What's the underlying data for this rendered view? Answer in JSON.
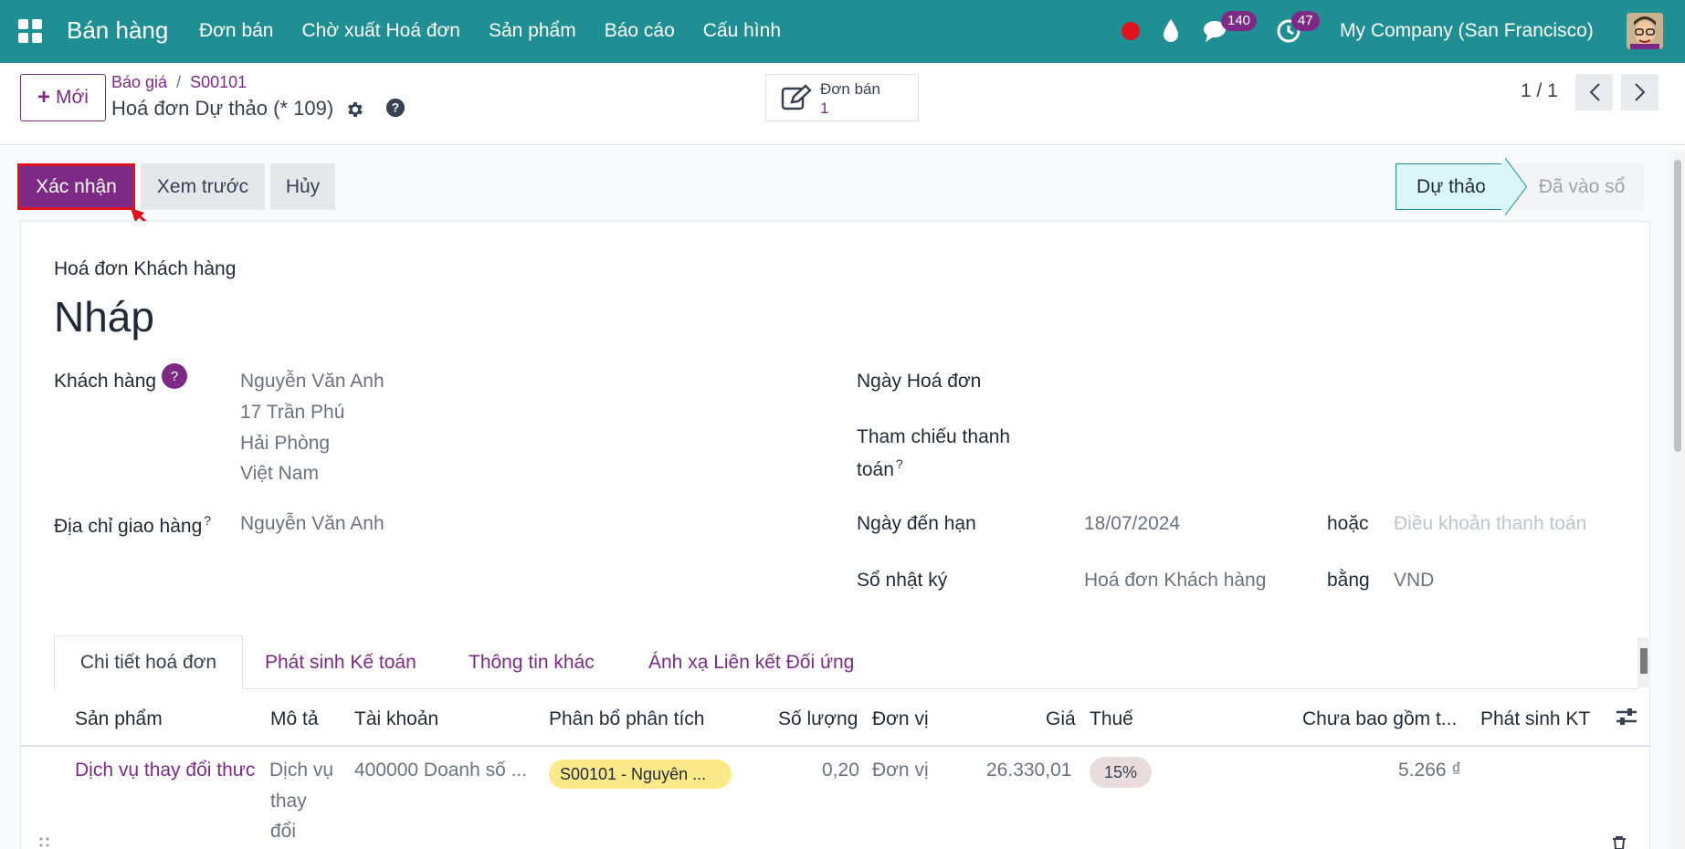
{
  "navbar": {
    "brand": "Bán hàng",
    "menu": [
      "Đơn bán",
      "Chờ xuất Hoá đơn",
      "Sản phẩm",
      "Báo cáo",
      "Cấu hình"
    ],
    "messages_count": "140",
    "activities_count": "47",
    "company": "My Company (San Francisco)",
    "color": "#1f8f94"
  },
  "control": {
    "new_label": "Mới",
    "breadcrumb": [
      "Báo giá",
      "S00101"
    ],
    "record_title": "Hoá đơn Dự thảo (* 109)",
    "smart_button": {
      "label": "Đơn bán",
      "value": "1"
    },
    "pager": "1 / 1"
  },
  "actions": {
    "confirm": "Xác nhận",
    "preview": "Xem trước",
    "cancel": "Hủy"
  },
  "statusbar": {
    "current": "Dự thảo",
    "next": "Đã vào sổ"
  },
  "form": {
    "doc_type": "Hoá đơn Khách hàng",
    "doc_name": "Nháp",
    "customer_label": "Khách hàng",
    "customer_help": "?",
    "customer_lines": [
      "Nguyễn Văn Anh",
      "17 Trần Phú",
      "Hải Phòng",
      "Việt Nam"
    ],
    "delivery_label": "Địa chỉ giao hàng",
    "delivery_value": "Nguyễn Văn Anh",
    "invoice_date_label": "Ngày Hoá đơn",
    "payment_ref_label_1": "Tham chiếu thanh",
    "payment_ref_label_2": "toán",
    "due_date_label": "Ngày đến hạn",
    "due_date_value": "18/07/2024",
    "or_label": "hoặc",
    "payment_terms_placeholder": "Điều khoản thanh toán",
    "journal_label": "Sổ nhật ký",
    "journal_value": "Hoá đơn Khách hàng",
    "currency_label": "bằng",
    "currency_value": "VND",
    "superscript_q": "?"
  },
  "tabs": [
    "Chi tiết hoá đơn",
    "Phát sinh Kế toán",
    "Thông tin khác",
    "Ánh xạ Liên kết Đối ứng"
  ],
  "table": {
    "headers": [
      "Sản phẩm",
      "Mô tả",
      "Tài khoản",
      "Phân bổ phân tích",
      "Số lượng",
      "Đơn vị",
      "Giá",
      "Thuế",
      "Chưa bao gồm t...",
      "Phát sinh KT"
    ],
    "rows": [
      {
        "product": "Dịch vụ thay đổi thưc",
        "description": [
          "Dịch vụ",
          "thay",
          "đổi"
        ],
        "account": "400000 Doanh số ...",
        "analytic": "S00101 - Nguyên ...",
        "quantity": "0,20",
        "uom": "Đơn vị",
        "price": "26.330,01",
        "tax": "15%",
        "subtotal": "5.266 ₫"
      }
    ]
  }
}
